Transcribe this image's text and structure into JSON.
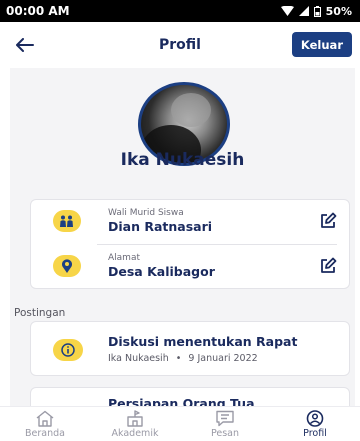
{
  "status_bar": {
    "time": "00:00 AM",
    "battery": "50%"
  },
  "header": {
    "title": "Profil",
    "logout_label": "Keluar"
  },
  "profile": {
    "name": "Ika Nukaesih",
    "guardian_label": "Wali Murid Siswa",
    "guardian_name": "Dian Ratnasari",
    "address_label": "Alamat",
    "address_value": "Desa Kalibagor"
  },
  "posts": {
    "section_label": "Postingan",
    "items": [
      {
        "title": "Diskusi menentukan Rapat",
        "author": "Ika Nukaesih",
        "separator": "•",
        "date": "9 Januari 2022"
      },
      {
        "title": "Persiapan Orang Tua",
        "author": "",
        "separator": "",
        "date": ""
      }
    ]
  },
  "bottom_nav": {
    "items": [
      {
        "label": "Beranda",
        "icon": "home-icon",
        "active": false
      },
      {
        "label": "Akademik",
        "icon": "school-icon",
        "active": false
      },
      {
        "label": "Pesan",
        "icon": "message-icon",
        "active": false
      },
      {
        "label": "Profil",
        "icon": "profile-icon",
        "active": true
      }
    ]
  },
  "colors": {
    "primary": "#1c3f83",
    "accent": "#f7d548",
    "background": "#f4f4f6"
  }
}
